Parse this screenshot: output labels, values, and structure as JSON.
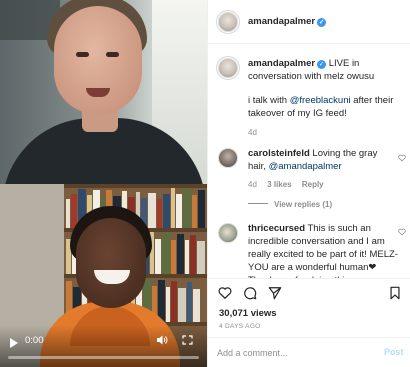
{
  "video": {
    "time": "0:00",
    "controls": {
      "play_icon": "play-icon",
      "volume_icon": "volume-icon",
      "fullscreen_icon": "fullscreen-icon"
    }
  },
  "post": {
    "username": "amandapalmer",
    "verified_icon": "verified-badge-icon",
    "caption": {
      "username": "amandapalmer",
      "line1": "LIVE in conversation with melz owusu",
      "line2_before": "i talk with ",
      "line2_mention": "@freeblackuni",
      "line2_after": " after their takeover of my IG feed!",
      "age": "4d"
    },
    "comments": [
      {
        "username": "carolsteinfeld",
        "text": "Loving the gray hair, ",
        "mention": "@amandapalmer",
        "age": "4d",
        "likes": "3 likes",
        "reply": "Reply",
        "view_replies": "View replies (1)"
      },
      {
        "username": "thricecursed",
        "text": "This is such an incredible conversation and I am really excited to be part of it! MELZ- YOU are a wonderful human❤ Thank you for doing this"
      }
    ],
    "views": "30,071 views",
    "posted": "4 DAYS AGO",
    "comment_placeholder": "Add a comment...",
    "post_label": "Post",
    "colors": {
      "link": "#00376b",
      "verified": "#3897f0",
      "post_disabled": "#b2dffc",
      "muted": "#8e8e8e"
    }
  }
}
